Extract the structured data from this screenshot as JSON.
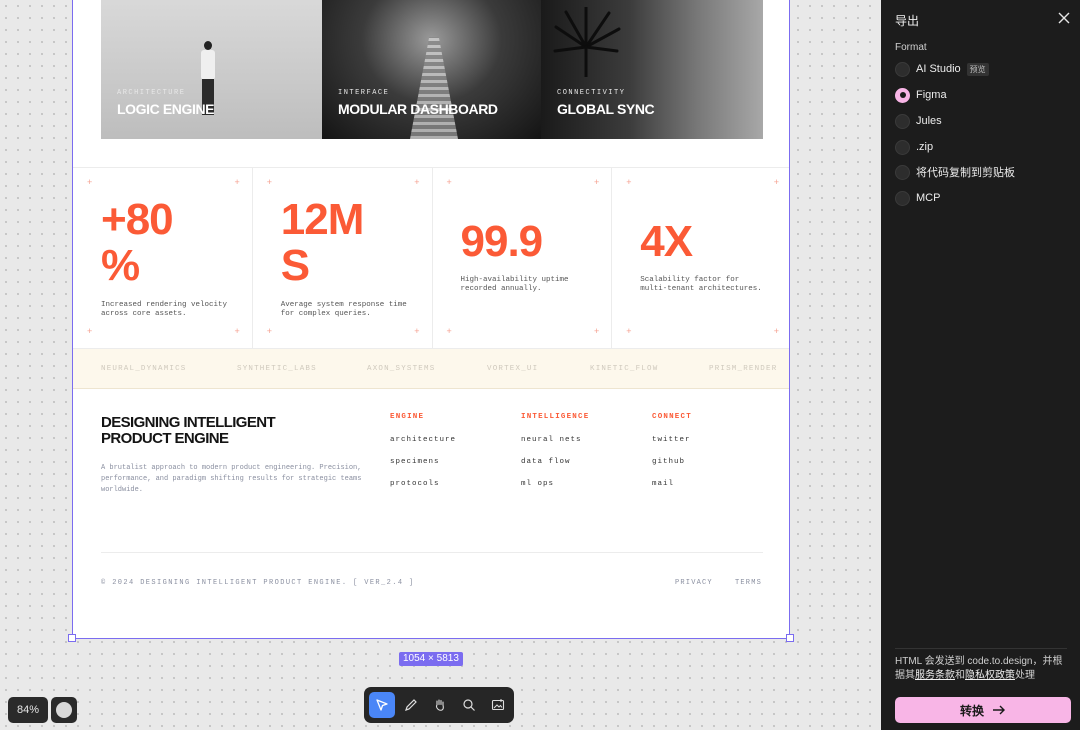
{
  "canvas": {
    "frame_size": "1054 × 5813",
    "zoom_level": "84%",
    "hero": [
      {
        "kicker": "ARCHITECTURE",
        "title": "LOGIC ENGINE"
      },
      {
        "kicker": "INTERFACE",
        "title": "MODULAR DASHBOARD"
      },
      {
        "kicker": "CONNECTIVITY",
        "title": "GLOBAL SYNC"
      }
    ],
    "stats": [
      {
        "value_line1": "+80",
        "value_line2": "%",
        "desc": "Increased rendering velocity across core assets."
      },
      {
        "value_line1": "12M",
        "value_line2": "S",
        "desc": "Average system response time for complex queries."
      },
      {
        "value_line1": "99.9",
        "value_line2": "",
        "desc": "High-availability uptime recorded annually."
      },
      {
        "value_line1": "4X",
        "value_line2": "",
        "desc": "Scalability factor for multi-tenant architectures."
      }
    ],
    "ribbon": [
      "NEURAL_DYNAMICS",
      "SYNTHETIC_LABS",
      "AXON_SYSTEMS",
      "VORTEX_UI",
      "KINETIC_FLOW",
      "PRISM_RENDER"
    ],
    "footer": {
      "title": "DESIGNING INTELLIGENT PRODUCT ENGINE",
      "blurb": "A brutalist approach to modern product engineering. Precision, performance, and paradigm shifting results for strategic teams worldwide.",
      "columns": [
        {
          "heading": "ENGINE",
          "links": [
            "architecture",
            "specimens",
            "protocols"
          ]
        },
        {
          "heading": "INTELLIGENCE",
          "links": [
            "neural nets",
            "data flow",
            "ml ops"
          ]
        },
        {
          "heading": "CONNECT",
          "links": [
            "twitter",
            "github",
            "mail"
          ]
        }
      ],
      "copyright": "© 2024 DESIGNING INTELLIGENT PRODUCT ENGINE. [ VER_2.4 ]",
      "privacy": "PRIVACY",
      "terms": "TERMS"
    }
  },
  "toolbar": {
    "tools": [
      "select-icon",
      "pen-icon",
      "hand-icon",
      "search-icon",
      "image-icon"
    ],
    "active_tool": "select-icon"
  },
  "export_panel": {
    "title": "导出",
    "format_label": "Format",
    "options": [
      {
        "label": "AI Studio",
        "badge": "预览"
      },
      {
        "label": "Figma",
        "badge": ""
      },
      {
        "label": "Jules",
        "badge": ""
      },
      {
        "label": ".zip",
        "badge": ""
      },
      {
        "label": "将代码复制到剪贴板",
        "badge": ""
      },
      {
        "label": "MCP",
        "badge": ""
      }
    ],
    "selected_option": "Figma",
    "note_prefix": "HTML 会发送到 code.to.design，并根据其",
    "note_terms": "服务条款",
    "note_and": "和",
    "note_privacy": "隐私权政策",
    "note_suffix": "处理",
    "convert_label": "转换",
    "accent": "#f8b5e6"
  },
  "colors": {
    "brand_orange": "#fb5a36",
    "selection_purple": "#7b6cf0",
    "active_tool_blue": "#4a86f7"
  }
}
